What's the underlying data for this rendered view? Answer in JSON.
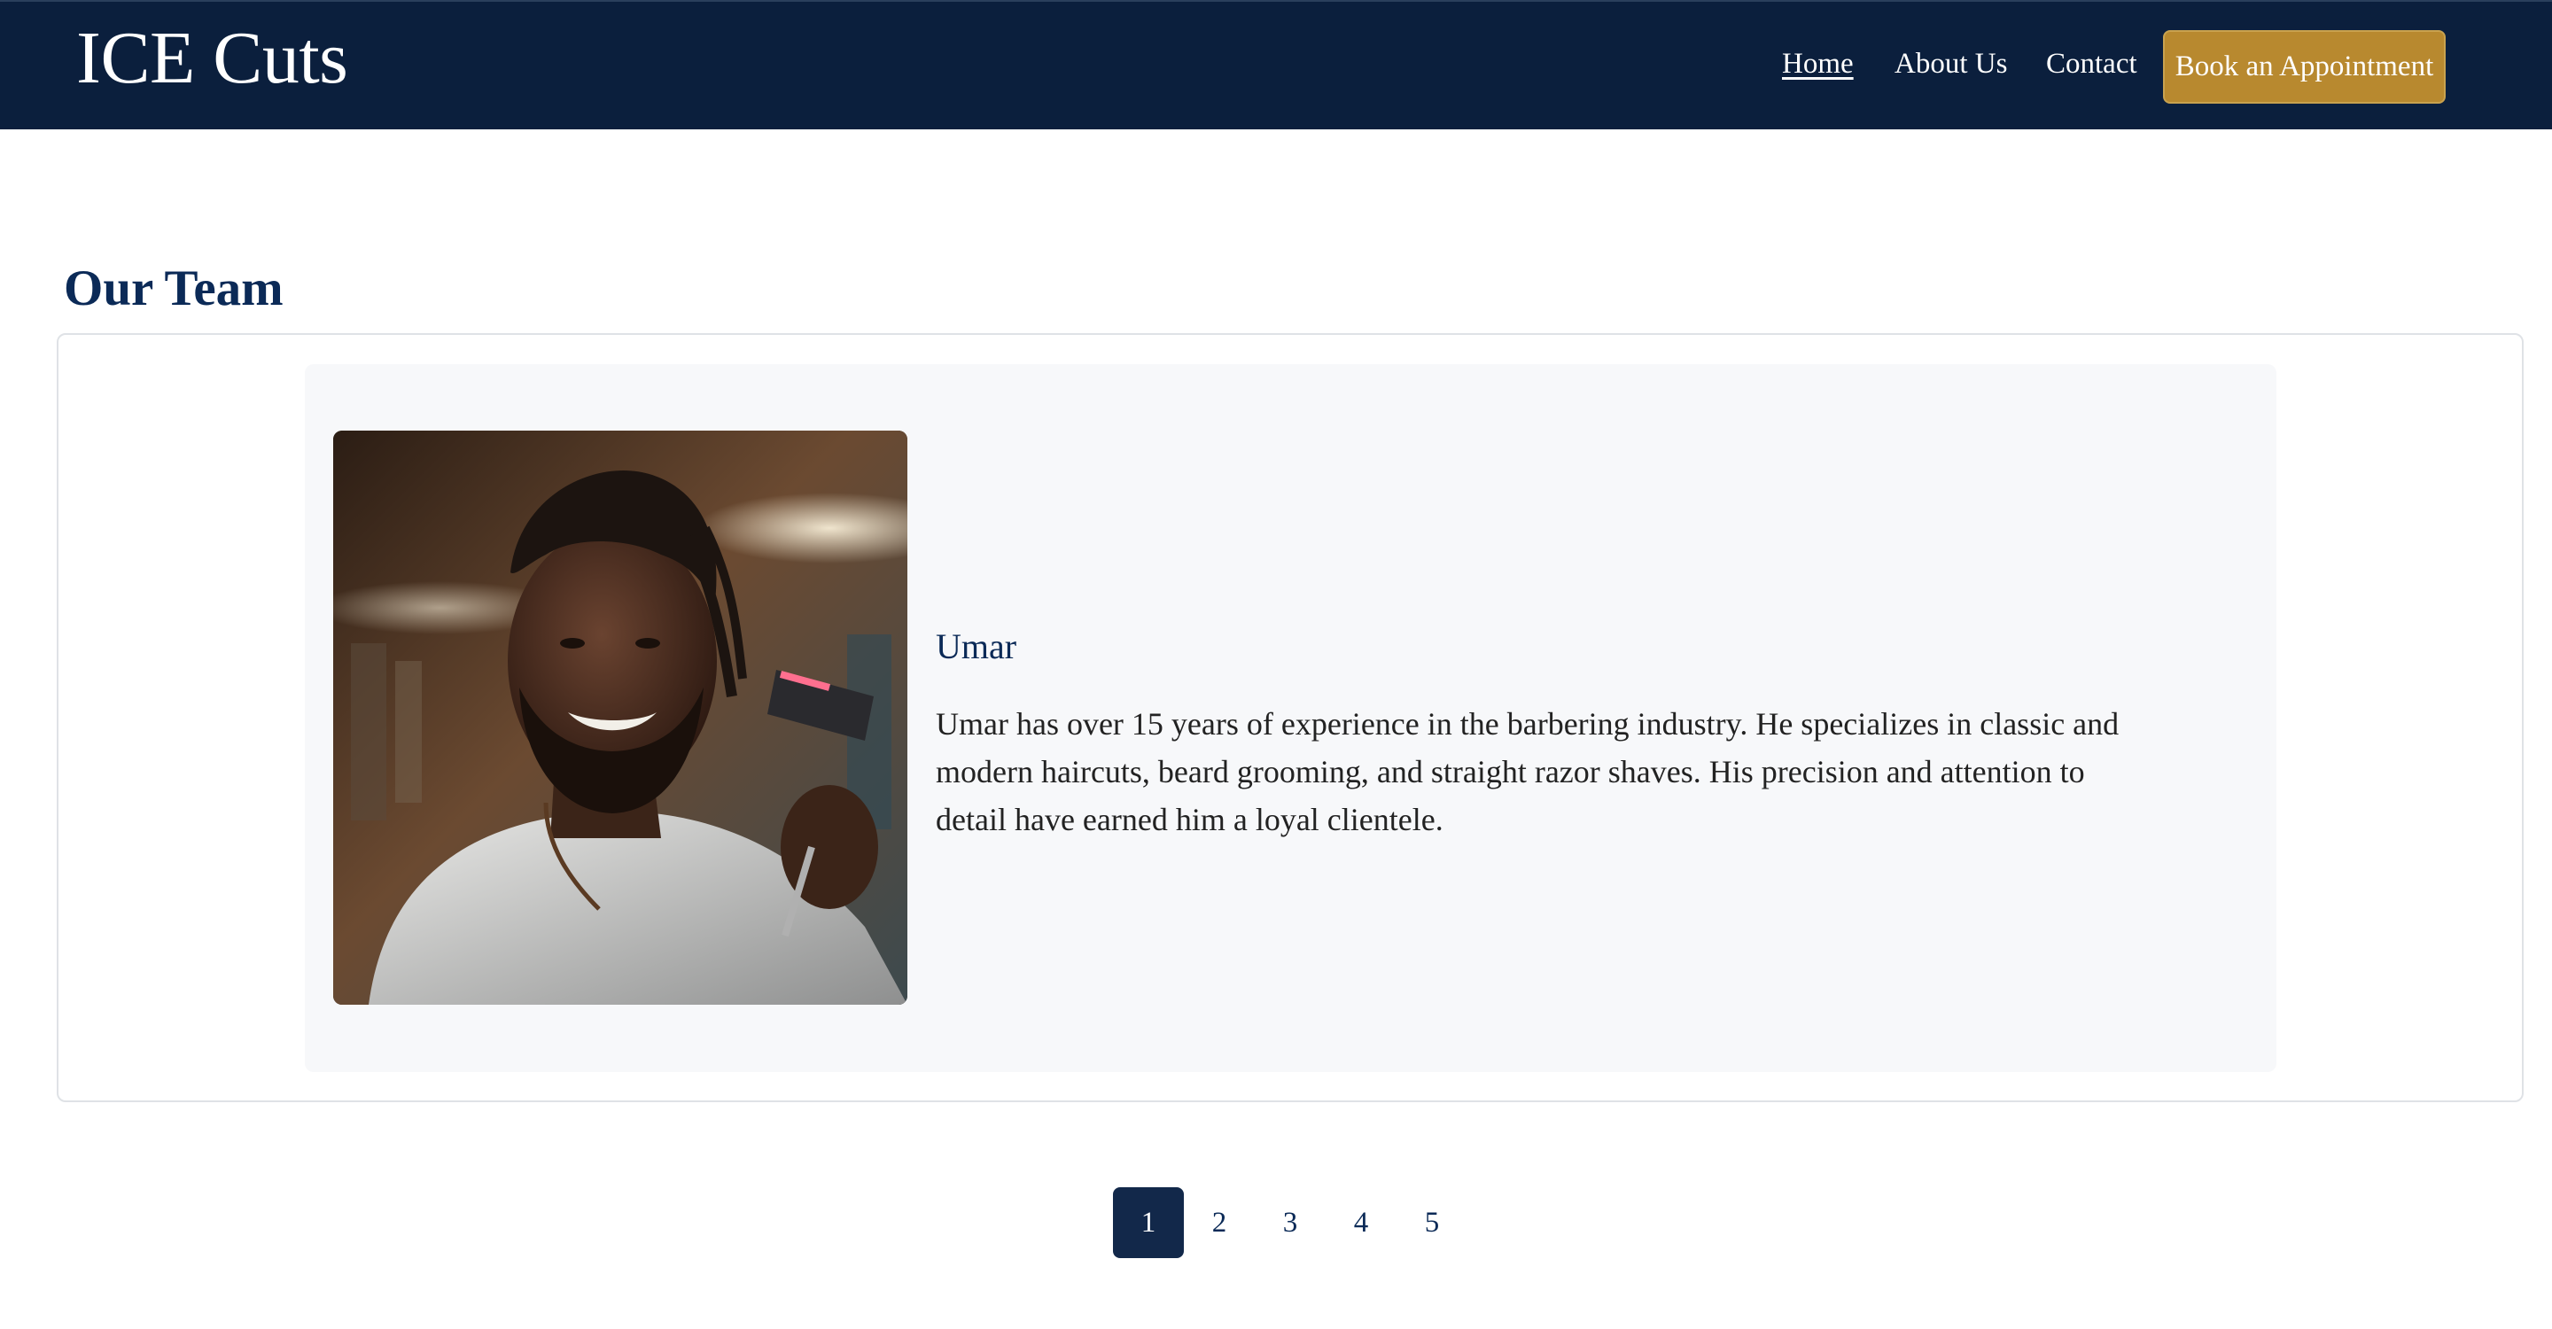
{
  "header": {
    "brand": "ICE Cuts",
    "nav": [
      {
        "label": "Home",
        "active": true
      },
      {
        "label": "About Us",
        "active": false
      },
      {
        "label": "Contact",
        "active": false
      }
    ],
    "cta_label": "Book an Appointment"
  },
  "team": {
    "title": "Our Team",
    "member": {
      "name": "Umar",
      "bio": "Umar has over 15 years of experience in the barbering industry. He specializes in classic and modern haircuts, beard grooming, and straight razor shaves. His precision and attention to detail have earned him a loyal clientele."
    }
  },
  "pagination": {
    "pages": [
      "1",
      "2",
      "3",
      "4",
      "5"
    ],
    "current": "1"
  },
  "colors": {
    "header_bg": "#0b1f3d",
    "accent_gold": "#b8892f",
    "heading_navy": "#0b2a57",
    "card_bg": "#f7f8fa",
    "active_page_bg": "#12284a"
  }
}
